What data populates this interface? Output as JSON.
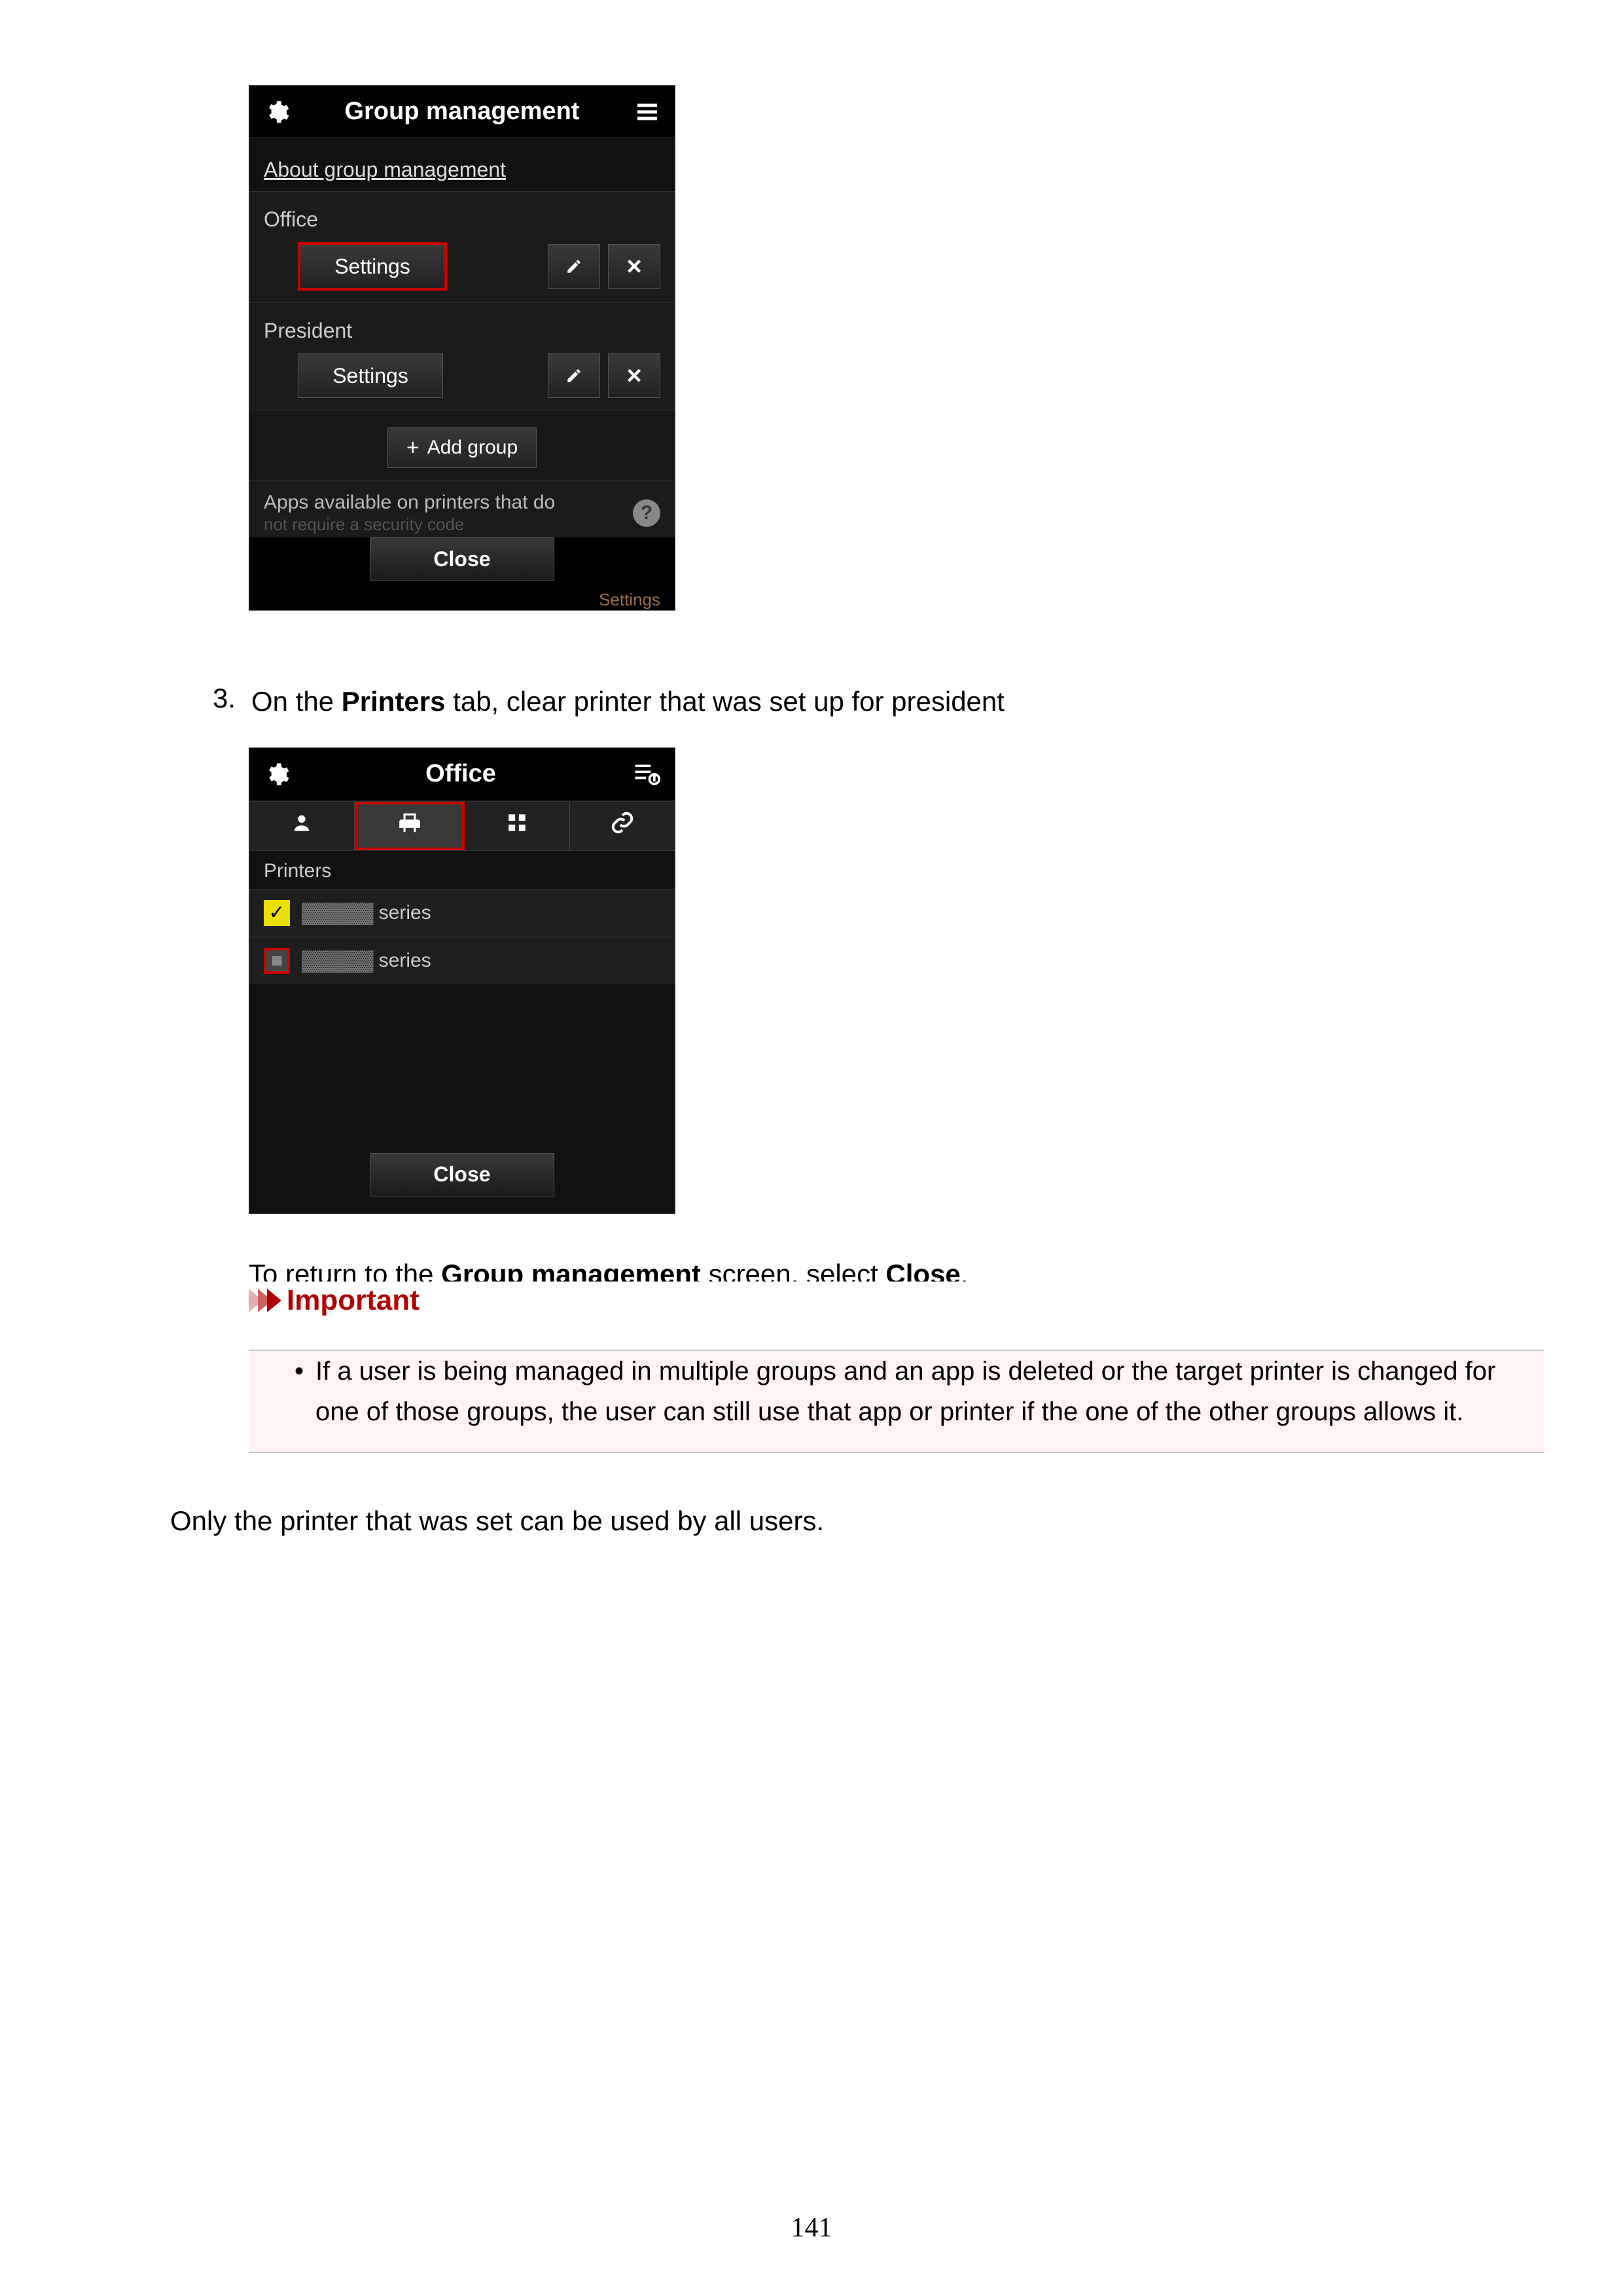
{
  "phone1": {
    "title": "Group management",
    "about_link": "About group management",
    "groups": [
      {
        "name": "Office",
        "settings_label": "Settings",
        "highlighted": true
      },
      {
        "name": "President",
        "settings_label": "Settings",
        "highlighted": false
      }
    ],
    "add_group_label": "Add group",
    "apps_line1": "Apps available on printers that do",
    "apps_line2": "not require a security code",
    "help_symbol": "?",
    "close_label": "Close",
    "ghost_label": "Settings"
  },
  "step3": {
    "number": "3.",
    "prefix": "On the ",
    "bold1": "Printers",
    "suffix": " tab, clear printer that was set up for president"
  },
  "phone2": {
    "title": "Office",
    "tabs": [
      "user",
      "printers",
      "apps",
      "link"
    ],
    "section_label": "Printers",
    "rows": [
      {
        "checked": true,
        "prefix_blur": "",
        "label": "series",
        "highlighted": false
      },
      {
        "checked": false,
        "prefix_blur": "",
        "label": "series",
        "highlighted": true
      }
    ],
    "close_label": "Close"
  },
  "return_text": {
    "prefix": "To return to the ",
    "bold1": "Group management",
    "mid": " screen, select ",
    "bold2": "Close",
    "suffix": "."
  },
  "important": {
    "title": "Important",
    "bullet": "If a user is being managed in multiple groups and an app is deleted or the target printer is changed for one of those groups, the user can still use that app or printer if the one of the other groups allows it."
  },
  "final_line": "Only the printer that was set can be used by all users.",
  "page_number": "141"
}
